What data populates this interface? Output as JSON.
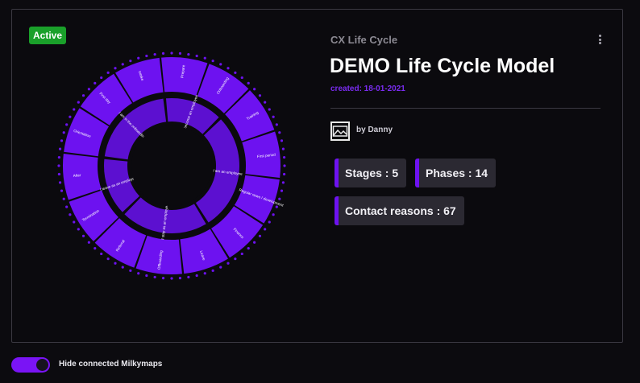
{
  "card": {
    "status_badge": "Active",
    "category": "CX Life Cycle",
    "title": "DEMO Life Cycle Model",
    "created": "created: 18-01-2021",
    "author": "by Danny",
    "stats": [
      {
        "label": "Stages : 5"
      },
      {
        "label": "Phases : 14"
      },
      {
        "label": "Contact reasons : 67"
      }
    ]
  },
  "wheel": {
    "colors": {
      "primary": "#6d12f0",
      "secondary": "#5c10d0",
      "dots": "#6d12f0"
    },
    "stages": [
      {
        "label": "I become an employee",
        "span": 2
      },
      {
        "label": "I am an employee",
        "span": 4
      },
      {
        "label": "I stay as an employee",
        "span": 3
      },
      {
        "label": "I leave as an employee",
        "span": 2
      },
      {
        "label": "I am in the onboarding",
        "span": 3
      }
    ],
    "phases": [
      {
        "label": "Prepare"
      },
      {
        "label": "Onboarding"
      },
      {
        "label": "Training"
      },
      {
        "label": "First period"
      },
      {
        "label": "Regular news / development"
      },
      {
        "label": "Finance"
      },
      {
        "label": "Leave"
      },
      {
        "label": "Offboarding"
      },
      {
        "label": "Referral"
      },
      {
        "label": "Termination"
      },
      {
        "label": "After"
      },
      {
        "label": "Orientation"
      },
      {
        "label": "First day"
      },
      {
        "label": "Intake"
      }
    ]
  },
  "footer": {
    "toggle_label": "Hide connected Milkymaps",
    "toggle_on": true
  },
  "icons": {
    "menu": "kebab-menu-icon",
    "avatar": "image-placeholder-icon"
  }
}
